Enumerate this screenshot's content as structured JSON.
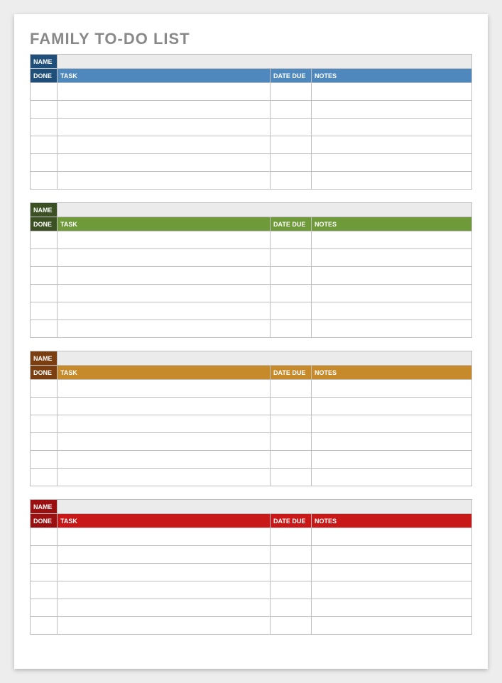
{
  "title": "FAMILY TO-DO LIST",
  "labels": {
    "name": "NAME",
    "done": "DONE",
    "task": "TASK",
    "date_due": "DATE DUE",
    "notes": "NOTES"
  },
  "sections": [
    {
      "id": "blue",
      "name_bg": "#1f4e79",
      "done_bg": "#1f4e79",
      "header_bg": "#4f88bc",
      "blank_rows": 6
    },
    {
      "id": "green",
      "name_bg": "#3b5023",
      "done_bg": "#3b5023",
      "header_bg": "#6e9a3a",
      "blank_rows": 6
    },
    {
      "id": "orange",
      "name_bg": "#7a3e11",
      "done_bg": "#7a3e11",
      "header_bg": "#c68a2b",
      "blank_rows": 6
    },
    {
      "id": "red",
      "name_bg": "#9a1010",
      "done_bg": "#9a1010",
      "header_bg": "#c81818",
      "blank_rows": 6
    }
  ]
}
